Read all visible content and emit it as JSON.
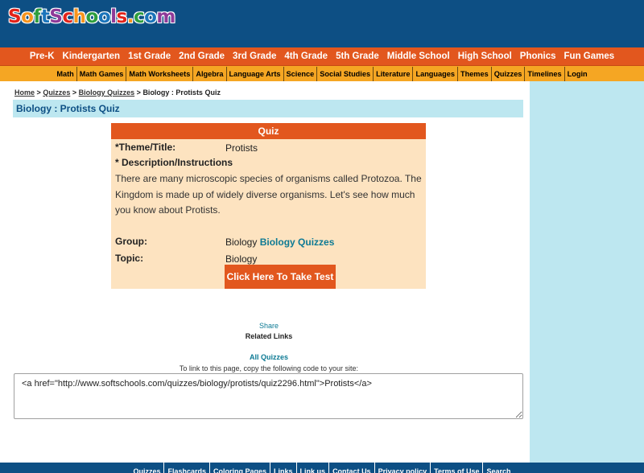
{
  "logo": {
    "text": "SoftSchools.com"
  },
  "nav_primary": [
    "Pre-K",
    "Kindergarten",
    "1st Grade",
    "2nd Grade",
    "3rd Grade",
    "4th Grade",
    "5th Grade",
    "Middle School",
    "High School",
    "Phonics",
    "Fun Games"
  ],
  "nav_secondary": [
    "Math",
    "Math Games",
    "Math Worksheets",
    "Algebra",
    "Language Arts",
    "Science",
    "Social Studies",
    "Literature",
    "Languages",
    "Themes",
    "Quizzes",
    "Timelines",
    "Login"
  ],
  "breadcrumb": {
    "home": "Home",
    "sep": ">",
    "quizzes": "Quizzes",
    "biology_quizzes": "Biology Quizzes",
    "current": "Biology : Protists Quiz"
  },
  "page_title": "Biology : Protists Quiz",
  "quiz": {
    "header": "Quiz",
    "theme_label": "*Theme/Title:",
    "theme_value": "Protists",
    "desc_label": "* Description/Instructions",
    "description": "There are many microscopic species of organisms called Protozoa. The Kingdom is made up of widely diverse organisms. Let's see how much you know about Protists.",
    "group_label": "Group:",
    "group_value": "Biology",
    "group_link": "Biology Quizzes",
    "topic_label": "Topic:",
    "topic_value": "Biology",
    "take_test_label": "Click Here To Take Test"
  },
  "share_label": "Share",
  "related_links_label": "Related Links",
  "all_quizzes_label": "All Quizzes",
  "link_instructions": "To link to this page, copy the following code to your site:",
  "link_code": "<a href=\"http://www.softschools.com/quizzes/biology/protists/quiz2296.html\">Protists</a>",
  "footer_links": [
    "Quizzes",
    "Flashcards",
    "Coloring Pages",
    "Links",
    "Link us",
    "Contact Us",
    "Privacy policy",
    "Terms of Use",
    "Search"
  ],
  "colors": {
    "header_blue": "#0d4f84",
    "nav_orange": "#e2571e",
    "nav_yellow": "#f5a623",
    "quiz_bg": "#fde3c0",
    "sidebar_blue": "#bde7f0",
    "link_teal": "#0d7a94"
  }
}
